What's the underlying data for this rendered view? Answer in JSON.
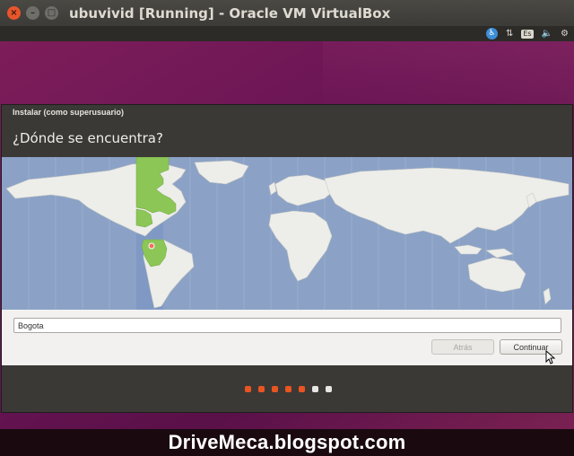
{
  "window": {
    "title": "ubuvivid [Running] - Oracle VM VirtualBox",
    "close_glyph": "×",
    "minimize_glyph": "–",
    "maximize_glyph": "□"
  },
  "panel": {
    "accessibility_glyph": "♿",
    "network_glyph": "⇅",
    "keyboard_label": "Es",
    "volume_glyph": "🔈",
    "settings_glyph": "⚙"
  },
  "installer": {
    "window_title": "Instalar (como superusuario)",
    "heading": "¿Dónde se encuentra?",
    "timezone_map": {
      "selected_city": "Bogota",
      "highlight_color": "#8cc657",
      "ocean_color": "#8ba2c6",
      "land_color": "#ededea"
    },
    "city_field_value": "Bogota",
    "back_button": "Atrás",
    "continue_button": "Continuar",
    "progress": {
      "total_steps": 7,
      "completed_steps": 5,
      "active_color": "#e95420",
      "inactive_color": "#e8e6e3"
    }
  },
  "watermark": "DriveMeca.blogspot.com"
}
